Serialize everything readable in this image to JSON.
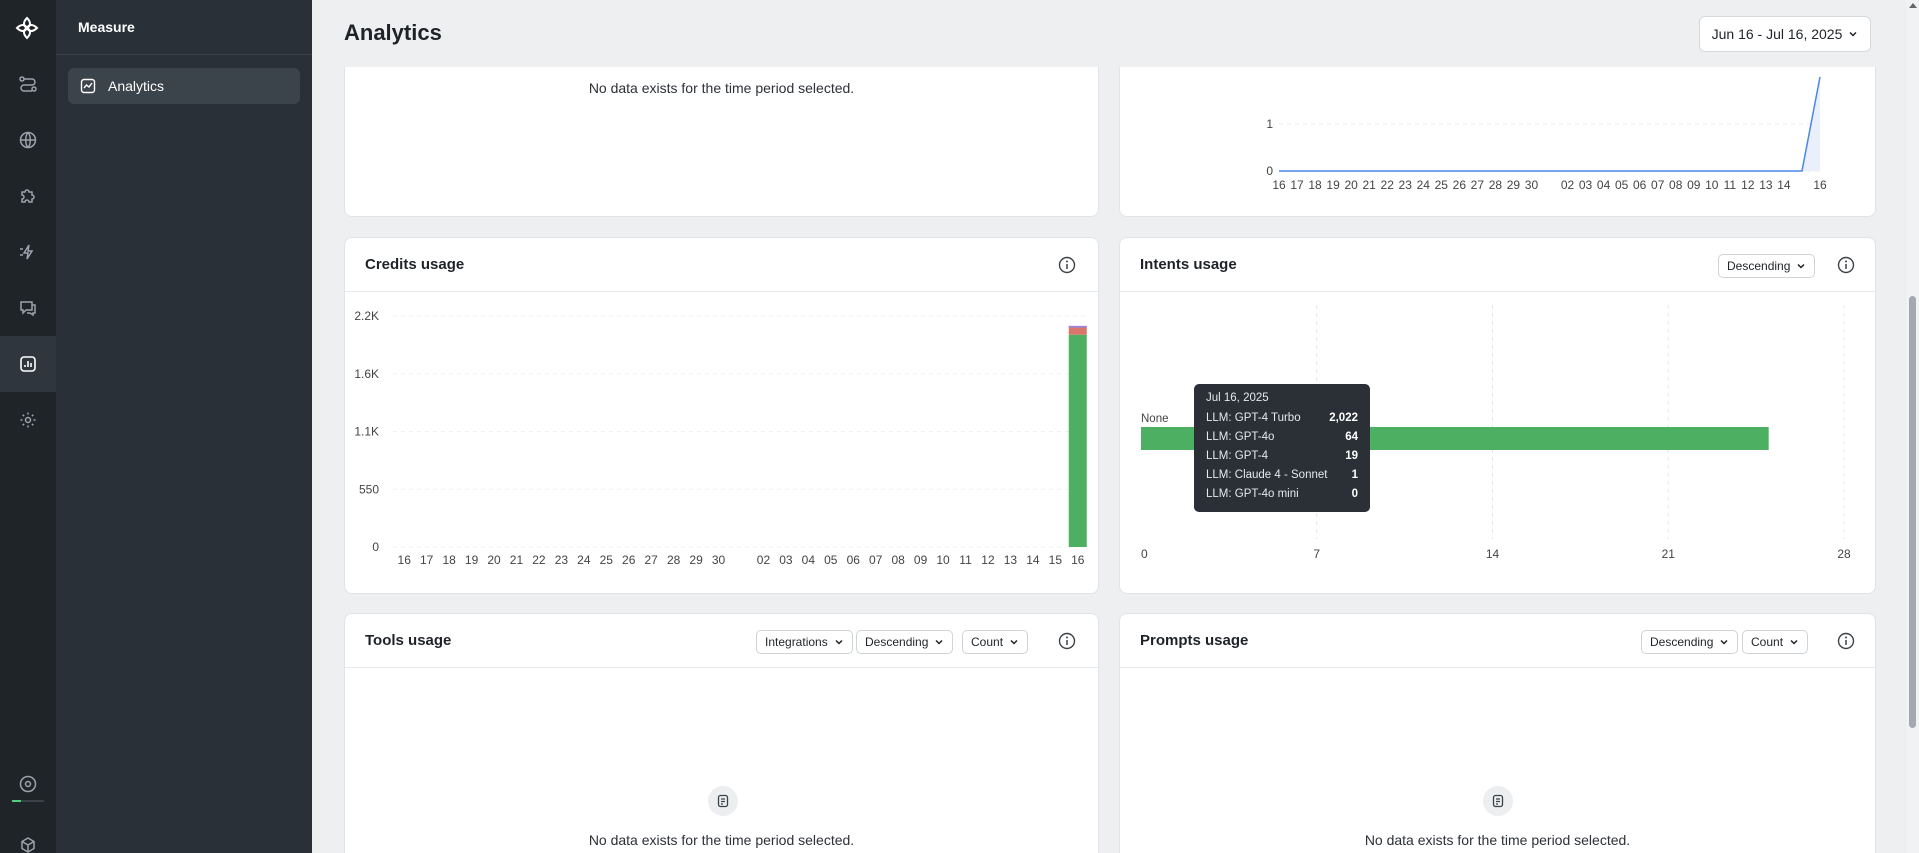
{
  "app": {
    "section_title": "Measure",
    "nav_item_label": "Analytics",
    "page_title": "Analytics",
    "date_range": "Jun 16 - Jul 16, 2025"
  },
  "rail": {
    "icons": [
      "logo-icon",
      "flows-icon",
      "globe-icon",
      "puzzle-icon",
      "actions-icon",
      "chat-icon",
      "analytics-icon",
      "settings-icon",
      "help-icon",
      "box-icon"
    ]
  },
  "top_left_card": {
    "empty_text": "No data exists for the time period selected."
  },
  "top_right_chart": {
    "chart_data": {
      "type": "line",
      "x": [
        "16",
        "17",
        "18",
        "19",
        "20",
        "21",
        "22",
        "23",
        "24",
        "25",
        "26",
        "27",
        "28",
        "29",
        "30",
        "",
        "02",
        "03",
        "04",
        "05",
        "06",
        "07",
        "08",
        "09",
        "10",
        "11",
        "12",
        "13",
        "14",
        "",
        "16"
      ],
      "x_tick_labels": [
        "16",
        "17",
        "18",
        "19",
        "20",
        "21",
        "22",
        "23",
        "24",
        "25",
        "26",
        "27",
        "28",
        "29",
        "30",
        "02",
        "03",
        "04",
        "05",
        "06",
        "07",
        "08",
        "09",
        "10",
        "11",
        "12",
        "13",
        "14",
        "16"
      ],
      "y_tick_labels": [
        "0",
        "1"
      ],
      "values": [
        0,
        0,
        0,
        0,
        0,
        0,
        0,
        0,
        0,
        0,
        0,
        0,
        0,
        0,
        0,
        0,
        0,
        0,
        0,
        0,
        0,
        0,
        0,
        0,
        0,
        0,
        0,
        0,
        0,
        0,
        2
      ],
      "color": "#4a86e8",
      "grid": true
    }
  },
  "credits_usage": {
    "title": "Credits usage",
    "chart_data": {
      "type": "bar",
      "stacked": true,
      "categories": [
        "16",
        "17",
        "18",
        "19",
        "20",
        "21",
        "22",
        "23",
        "24",
        "25",
        "26",
        "27",
        "28",
        "29",
        "30",
        "",
        "02",
        "03",
        "04",
        "05",
        "06",
        "07",
        "08",
        "09",
        "10",
        "11",
        "12",
        "13",
        "14",
        "15",
        "16"
      ],
      "y_tick_labels": [
        "0",
        "550",
        "1.1K",
        "1.6K",
        "2.2K"
      ],
      "ylim": [
        0,
        2200
      ],
      "series": [
        {
          "name": "LLM: GPT-4 Turbo",
          "color": "#4caf61",
          "values": [
            0,
            0,
            0,
            0,
            0,
            0,
            0,
            0,
            0,
            0,
            0,
            0,
            0,
            0,
            0,
            0,
            0,
            0,
            0,
            0,
            0,
            0,
            0,
            0,
            0,
            0,
            0,
            0,
            0,
            0,
            2022
          ]
        },
        {
          "name": "LLM: GPT-4o",
          "color": "#d9756b",
          "values": [
            0,
            0,
            0,
            0,
            0,
            0,
            0,
            0,
            0,
            0,
            0,
            0,
            0,
            0,
            0,
            0,
            0,
            0,
            0,
            0,
            0,
            0,
            0,
            0,
            0,
            0,
            0,
            0,
            0,
            0,
            64
          ]
        },
        {
          "name": "LLM: GPT-4",
          "color": "#8e8e93",
          "values": [
            0,
            0,
            0,
            0,
            0,
            0,
            0,
            0,
            0,
            0,
            0,
            0,
            0,
            0,
            0,
            0,
            0,
            0,
            0,
            0,
            0,
            0,
            0,
            0,
            0,
            0,
            0,
            0,
            0,
            0,
            19
          ]
        },
        {
          "name": "LLM: Claude 4 - Sonnet",
          "color": "#b07ad8",
          "values": [
            0,
            0,
            0,
            0,
            0,
            0,
            0,
            0,
            0,
            0,
            0,
            0,
            0,
            0,
            0,
            0,
            0,
            0,
            0,
            0,
            0,
            0,
            0,
            0,
            0,
            0,
            0,
            0,
            0,
            0,
            1
          ]
        },
        {
          "name": "LLM: GPT-4o mini",
          "color": "#f0b429",
          "values": [
            0,
            0,
            0,
            0,
            0,
            0,
            0,
            0,
            0,
            0,
            0,
            0,
            0,
            0,
            0,
            0,
            0,
            0,
            0,
            0,
            0,
            0,
            0,
            0,
            0,
            0,
            0,
            0,
            0,
            0,
            0
          ]
        }
      ],
      "grid": true
    },
    "tooltip": {
      "date": "Jul 16, 2025",
      "rows": [
        {
          "label": "LLM: GPT-4 Turbo",
          "value": "2,022"
        },
        {
          "label": "LLM: GPT-4o",
          "value": "64"
        },
        {
          "label": "LLM: GPT-4",
          "value": "19"
        },
        {
          "label": "LLM: Claude 4 - Sonnet",
          "value": "1"
        },
        {
          "label": "LLM: GPT-4o mini",
          "value": "0"
        }
      ]
    }
  },
  "intents_usage": {
    "title": "Intents usage",
    "sort_label": "Descending",
    "chart_data": {
      "type": "bar",
      "orientation": "horizontal",
      "categories": [
        "None"
      ],
      "values": [
        25
      ],
      "x_tick_labels": [
        "0",
        "7",
        "14",
        "21",
        "28"
      ],
      "xlim": [
        0,
        28
      ],
      "color": "#4caf61",
      "grid": true
    }
  },
  "tools_usage": {
    "title": "Tools usage",
    "filter_label": "Integrations",
    "sort_label": "Descending",
    "metric_label": "Count",
    "empty_text": "No data exists for the time period selected."
  },
  "prompts_usage": {
    "title": "Prompts usage",
    "sort_label": "Descending",
    "metric_label": "Count",
    "empty_text": "No data exists for the time period selected."
  }
}
